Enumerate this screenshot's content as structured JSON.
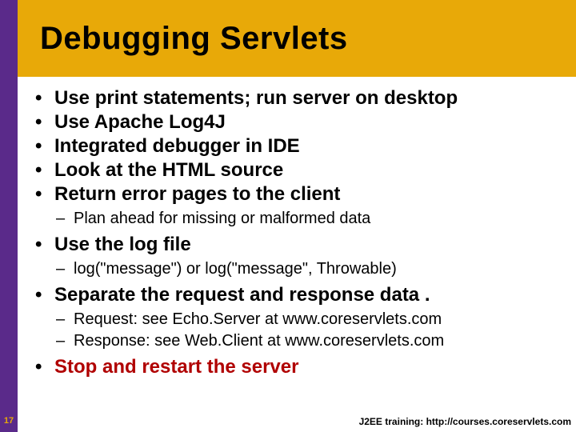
{
  "title": "Debugging Servlets",
  "bullets": {
    "b0": "Use print statements; run server on desktop",
    "b1": "Use Apache Log4J",
    "b2": "Integrated debugger in IDE",
    "b3": "Look at the HTML source",
    "b4": "Return error pages to the client",
    "b4s0": "Plan ahead for missing or malformed data",
    "b5": "Use the log file",
    "b5s0": "log(\"message\") or log(\"message\", Throwable)",
    "b6": "Separate the request and response data .",
    "b6s0": "Request: see Echo.Server at www.coreservlets.com",
    "b6s1": "Response: see Web.Client at www.coreservlets.com",
    "b7": "Stop and restart the server"
  },
  "page_number": "17",
  "footer": "J2EE training: http://courses.coreservlets.com"
}
